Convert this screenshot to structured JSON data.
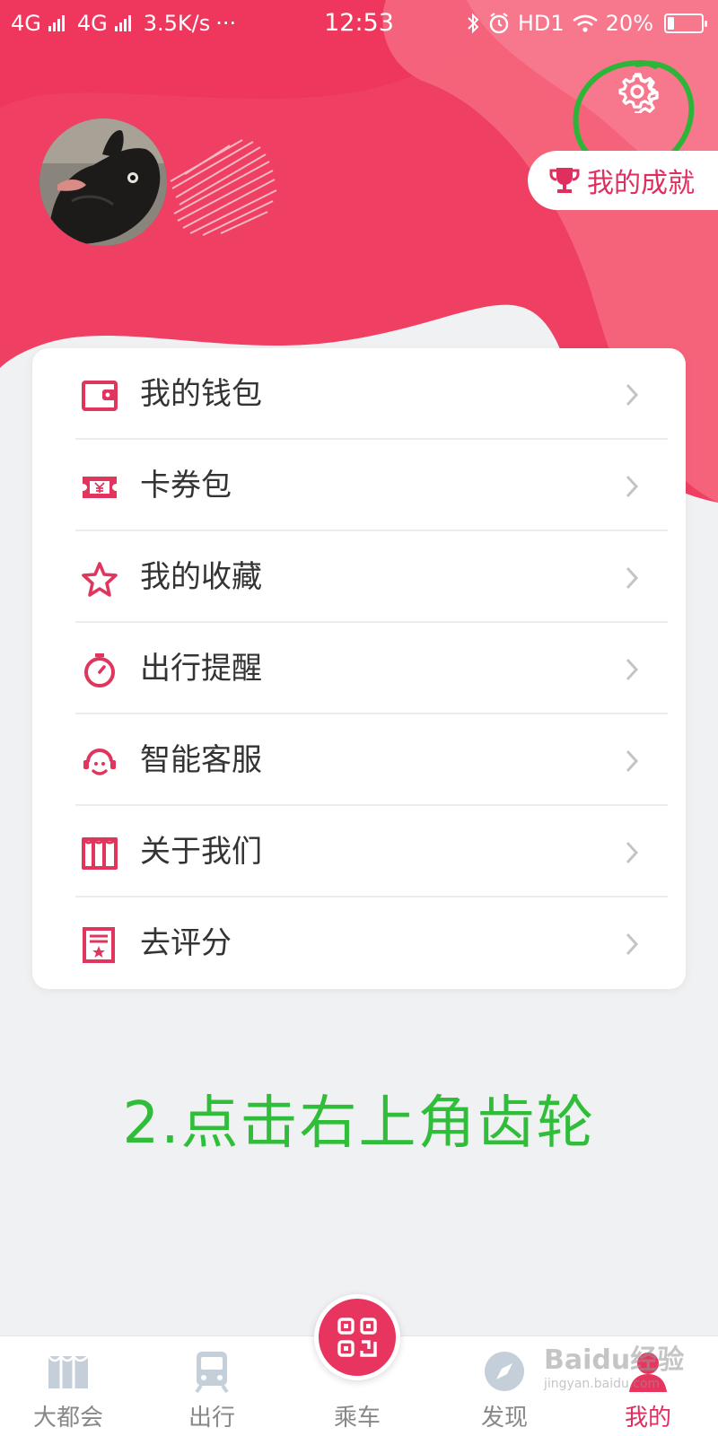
{
  "status_bar": {
    "network1": "4G",
    "network2": "4G",
    "speed": "3.5K/s",
    "more": "···",
    "time": "12:53",
    "hd": "HD1",
    "battery_percent": "20%",
    "battery_level": 0.2
  },
  "profile": {
    "achievement_label": "我的成就"
  },
  "menu": {
    "items": [
      {
        "label": "我的钱包",
        "icon": "wallet-icon"
      },
      {
        "label": "卡券包",
        "icon": "coupon-icon"
      },
      {
        "label": "我的收藏",
        "icon": "star-icon"
      },
      {
        "label": "出行提醒",
        "icon": "stopwatch-icon"
      },
      {
        "label": "智能客服",
        "icon": "headset-icon"
      },
      {
        "label": "关于我们",
        "icon": "metro-logo-icon"
      },
      {
        "label": "去评分",
        "icon": "rating-icon"
      }
    ]
  },
  "caption": "2.点击右上角齿轮",
  "tabbar": {
    "tabs": [
      {
        "label": "大都会",
        "icon": "metro-logo-icon",
        "active": false
      },
      {
        "label": "出行",
        "icon": "train-icon",
        "active": false
      },
      {
        "label": "乘车",
        "icon": "qr-code-icon",
        "active": false
      },
      {
        "label": "发现",
        "icon": "compass-icon",
        "active": false
      },
      {
        "label": "我的",
        "icon": "person-icon",
        "active": true
      }
    ]
  },
  "watermark": {
    "text": "Baidu经验",
    "url": "jingyan.baidu.com"
  },
  "colors": {
    "brand": "#e8355f",
    "annotation": "#2fbd3a"
  }
}
